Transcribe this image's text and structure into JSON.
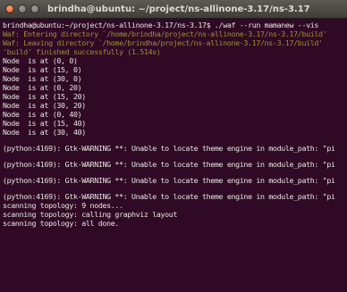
{
  "window": {
    "title": "brindha@ubuntu: ~/project/ns-allinone-3.17/ns-3.17"
  },
  "terminal": {
    "lines": [
      {
        "text": "brindha@ubuntu:~/project/ns-allinone-3.17/ns-3.17$ ./waf --run mamanew --vis",
        "kind": "prompt"
      },
      {
        "text": "Waf: Entering directory `/home/brindha/project/ns-allinone-3.17/ns-3.17/build'",
        "kind": "waf"
      },
      {
        "text": "Waf: Leaving directory `/home/brindha/project/ns-allinone-3.17/ns-3.17/build'",
        "kind": "waf"
      },
      {
        "text": "'build' finished successfully (1.514s)",
        "kind": "waf"
      },
      {
        "text": "Node  is at (0, 0)",
        "kind": "out"
      },
      {
        "text": "Node  is at (15, 0)",
        "kind": "out"
      },
      {
        "text": "Node  is at (30, 0)",
        "kind": "out"
      },
      {
        "text": "Node  is at (0, 20)",
        "kind": "out"
      },
      {
        "text": "Node  is at (15, 20)",
        "kind": "out"
      },
      {
        "text": "Node  is at (30, 20)",
        "kind": "out"
      },
      {
        "text": "Node  is at (0, 40)",
        "kind": "out"
      },
      {
        "text": "Node  is at (15, 40)",
        "kind": "out"
      },
      {
        "text": "Node  is at (30, 40)",
        "kind": "out"
      },
      {
        "text": "",
        "kind": "blank"
      },
      {
        "text": "(python:4169): Gtk-WARNING **: Unable to locate theme engine in module_path: \"pi",
        "kind": "warn"
      },
      {
        "text": "",
        "kind": "blank"
      },
      {
        "text": "(python:4169): Gtk-WARNING **: Unable to locate theme engine in module_path: \"pi",
        "kind": "warn"
      },
      {
        "text": "",
        "kind": "blank"
      },
      {
        "text": "(python:4169): Gtk-WARNING **: Unable to locate theme engine in module_path: \"pi",
        "kind": "warn"
      },
      {
        "text": "",
        "kind": "blank"
      },
      {
        "text": "(python:4169): Gtk-WARNING **: Unable to locate theme engine in module_path: \"pi",
        "kind": "warn"
      },
      {
        "text": "scanning topology: 9 nodes...",
        "kind": "out"
      },
      {
        "text": "scanning topology: calling graphviz layout",
        "kind": "out"
      },
      {
        "text": "scanning topology: all done.",
        "kind": "out"
      }
    ]
  },
  "colors": {
    "background": "#300a24",
    "text": "#e8e6e3",
    "waf_text": "#9c8f3c"
  }
}
